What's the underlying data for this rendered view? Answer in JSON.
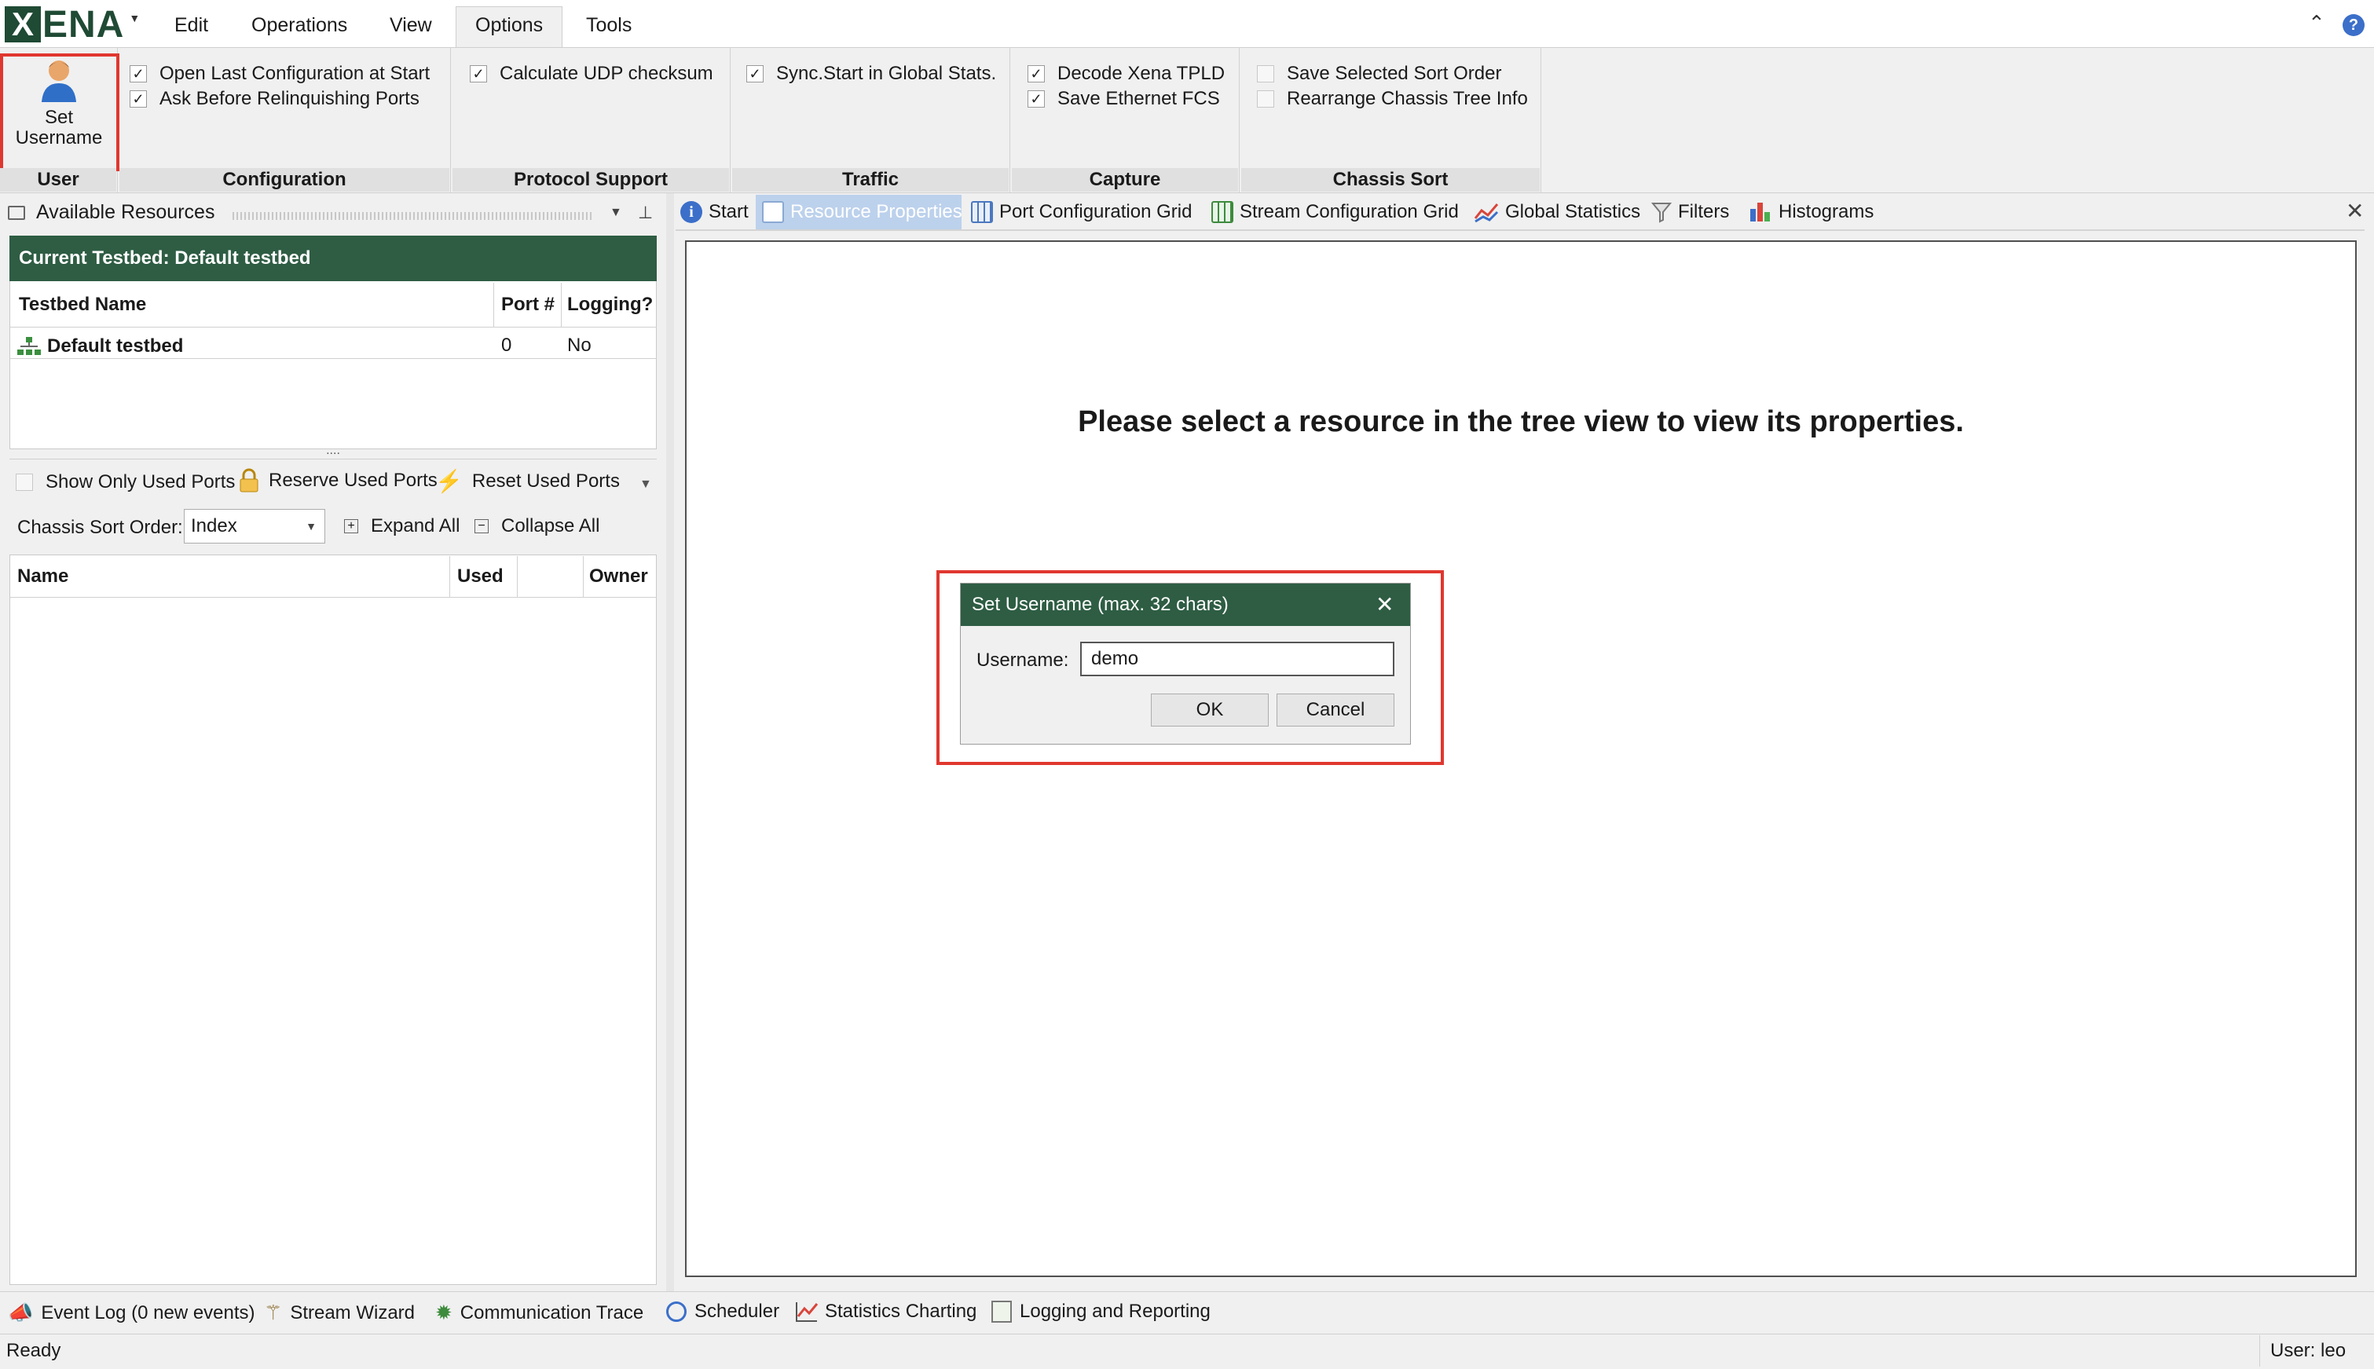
{
  "app": {
    "logo_initial": "X",
    "logo_rest": "ENA"
  },
  "menu": [
    "Edit",
    "Operations",
    "View",
    "Options",
    "Tools"
  ],
  "ribbon": {
    "user": {
      "button_line1": "Set",
      "button_line2": "Username",
      "label": "User"
    },
    "configuration": {
      "label": "Configuration",
      "items": [
        {
          "text": "Open Last Configuration at Start",
          "checked": true
        },
        {
          "text": "Ask Before Relinquishing Ports",
          "checked": true
        }
      ]
    },
    "protocol_support": {
      "label": "Protocol Support",
      "items": [
        {
          "text": "Calculate UDP checksum",
          "checked": true
        }
      ]
    },
    "traffic": {
      "label": "Traffic",
      "items": [
        {
          "text": "Sync.Start in Global Stats.",
          "checked": true
        }
      ]
    },
    "capture": {
      "label": "Capture",
      "items": [
        {
          "text": "Decode Xena TPLD",
          "checked": true
        },
        {
          "text": "Save Ethernet FCS",
          "checked": true
        }
      ]
    },
    "chassis_sort": {
      "label": "Chassis Sort",
      "items": [
        {
          "text": "Save Selected Sort Order",
          "checked": false
        },
        {
          "text": "Rearrange Chassis Tree Info",
          "checked": false
        }
      ]
    },
    "check_glyph": "✓"
  },
  "resources": {
    "title": "Available Resources",
    "current_testbed": "Current Testbed:  Default testbed",
    "columns": [
      "Testbed Name",
      "Port #",
      "Logging?"
    ],
    "rows": [
      {
        "name": "Default testbed",
        "port": "0",
        "logging": "No"
      }
    ],
    "splitter": "....",
    "toolbar": {
      "show_only": "Show Only Used Ports",
      "reserve": "Reserve Used Ports",
      "reset": "Reset Used Ports"
    },
    "sort_label": "Chassis Sort Order:",
    "sort_value": "Index",
    "expand": "Expand All",
    "collapse": "Collapse All",
    "tree_columns": [
      "Name",
      "Used",
      "",
      "Owner"
    ]
  },
  "tabs": [
    "Start",
    "Resource Properties",
    "Port Configuration Grid",
    "Stream Configuration Grid",
    "Global Statistics",
    "Filters",
    "Histograms"
  ],
  "main_message": "Please select a resource in the tree view to view its properties.",
  "dialog": {
    "title": "Set Username (max. 32 chars)",
    "field_label": "Username:",
    "field_value": "demo",
    "ok": "OK",
    "cancel": "Cancel"
  },
  "bottom_tabs": [
    "Event Log (0 new events)",
    "Stream Wizard",
    "Communication Trace",
    "Scheduler",
    "Statistics Charting",
    "Logging and Reporting"
  ],
  "status": {
    "left": "Ready",
    "right": "User: leo"
  },
  "colors": {
    "accent_green": "#2e5d43",
    "highlight_red": "#e0372f"
  }
}
